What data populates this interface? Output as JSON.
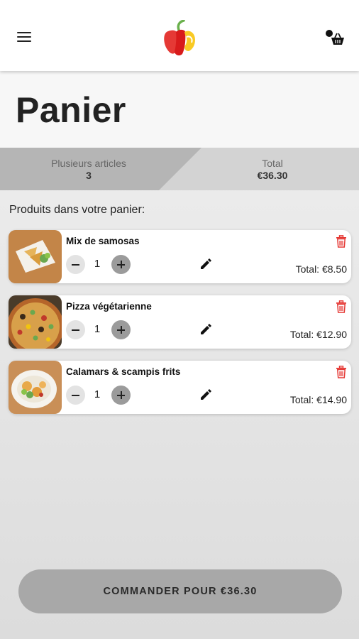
{
  "header": {
    "menu_icon": "hamburger-menu-icon",
    "logo_icon": "bell-pepper-logo",
    "account_cart_icon": "user-basket-icon"
  },
  "page": {
    "title": "Panier"
  },
  "summary": {
    "items_label": "Plusieurs articles",
    "items_count": "3",
    "total_label": "Total",
    "total_value": "€36.30"
  },
  "section_label": "Produits dans votre panier:",
  "products": [
    {
      "name": "Mix de samosas",
      "quantity": "1",
      "total": "Total: €8.50"
    },
    {
      "name": "Pizza végétarienne",
      "quantity": "1",
      "total": "Total: €12.90"
    },
    {
      "name": "Calamars & scampis frits",
      "quantity": "1",
      "total": "Total: €14.90"
    }
  ],
  "order_button": "COMMANDER POUR €36.30",
  "colors": {
    "delete": "#e53935",
    "order_button": "#a8a8a8",
    "summary_active": "#b5b5b5",
    "summary_inactive": "#d3d3d3"
  }
}
